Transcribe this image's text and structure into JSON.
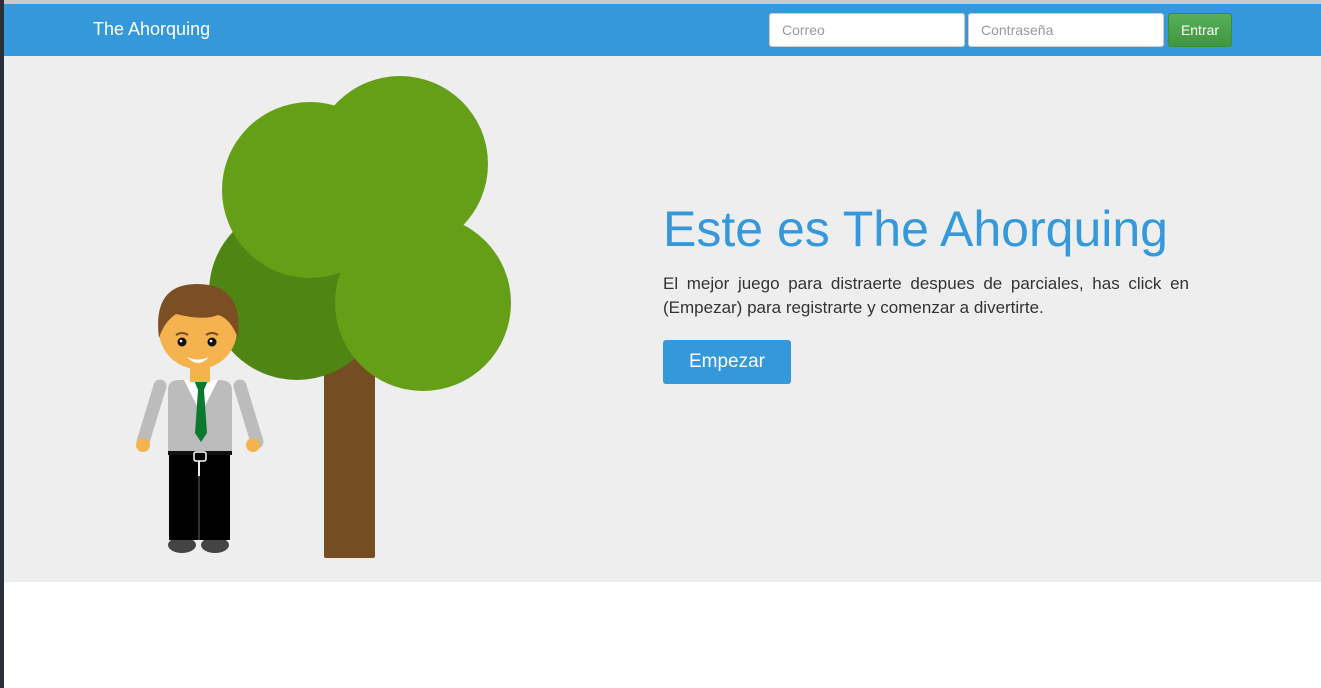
{
  "navbar": {
    "brand": "The Ahorquing",
    "email_placeholder": "Correo",
    "password_placeholder": "Contraseña",
    "login_label": "Entrar"
  },
  "hero": {
    "title": "Este es The Ahorquing",
    "text": "El mejor juego para distraerte despues de parciales, has click en (Empezar) para registrarte y comenzar a divertirte.",
    "start_label": "Empezar"
  },
  "colors": {
    "navbar": "#3498db",
    "hero_background": "#eeeeee",
    "title": "#3498db",
    "login_button": "#4cae4c",
    "tree_foliage": "#649f17",
    "tree_trunk": "#744d22"
  }
}
